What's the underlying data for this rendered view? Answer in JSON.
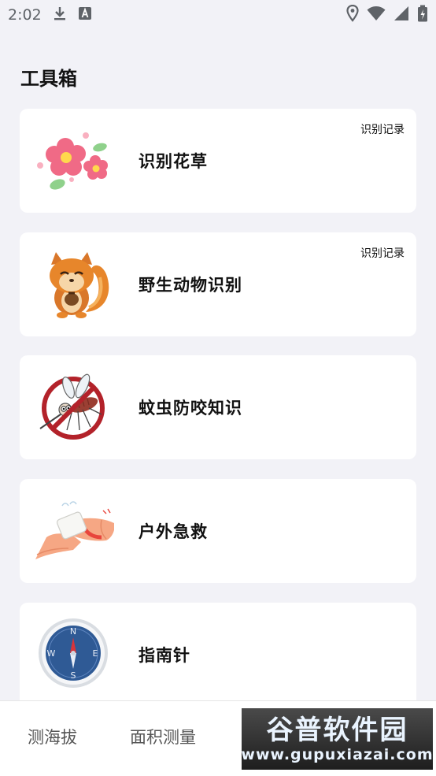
{
  "status_bar": {
    "time": "2:02",
    "icons": [
      "download-icon",
      "keyboard-a-icon",
      "location-icon",
      "wifi-icon",
      "signal-icon",
      "battery-charging-icon"
    ]
  },
  "page": {
    "title": "工具箱"
  },
  "cards": [
    {
      "title": "识别花草",
      "record_label": "识别记录",
      "icon": "flower-image"
    },
    {
      "title": "野生动物识别",
      "record_label": "识别记录",
      "icon": "squirrel-image"
    },
    {
      "title": "蚊虫防咬知识",
      "icon": "no-mosquito-image"
    },
    {
      "title": "户外急救",
      "icon": "bandage-wrist-image"
    },
    {
      "title": "指南针",
      "icon": "compass-image"
    }
  ],
  "bottom_nav": {
    "items": [
      {
        "label": "测海拔"
      },
      {
        "label": "面积测量"
      }
    ]
  },
  "watermark": {
    "brand": "谷普软件园",
    "url": "www.gupuxiazai.com"
  },
  "colors": {
    "background": "#f2f2f7",
    "card": "#ffffff",
    "text": "#111111",
    "nav_text": "#555555"
  }
}
